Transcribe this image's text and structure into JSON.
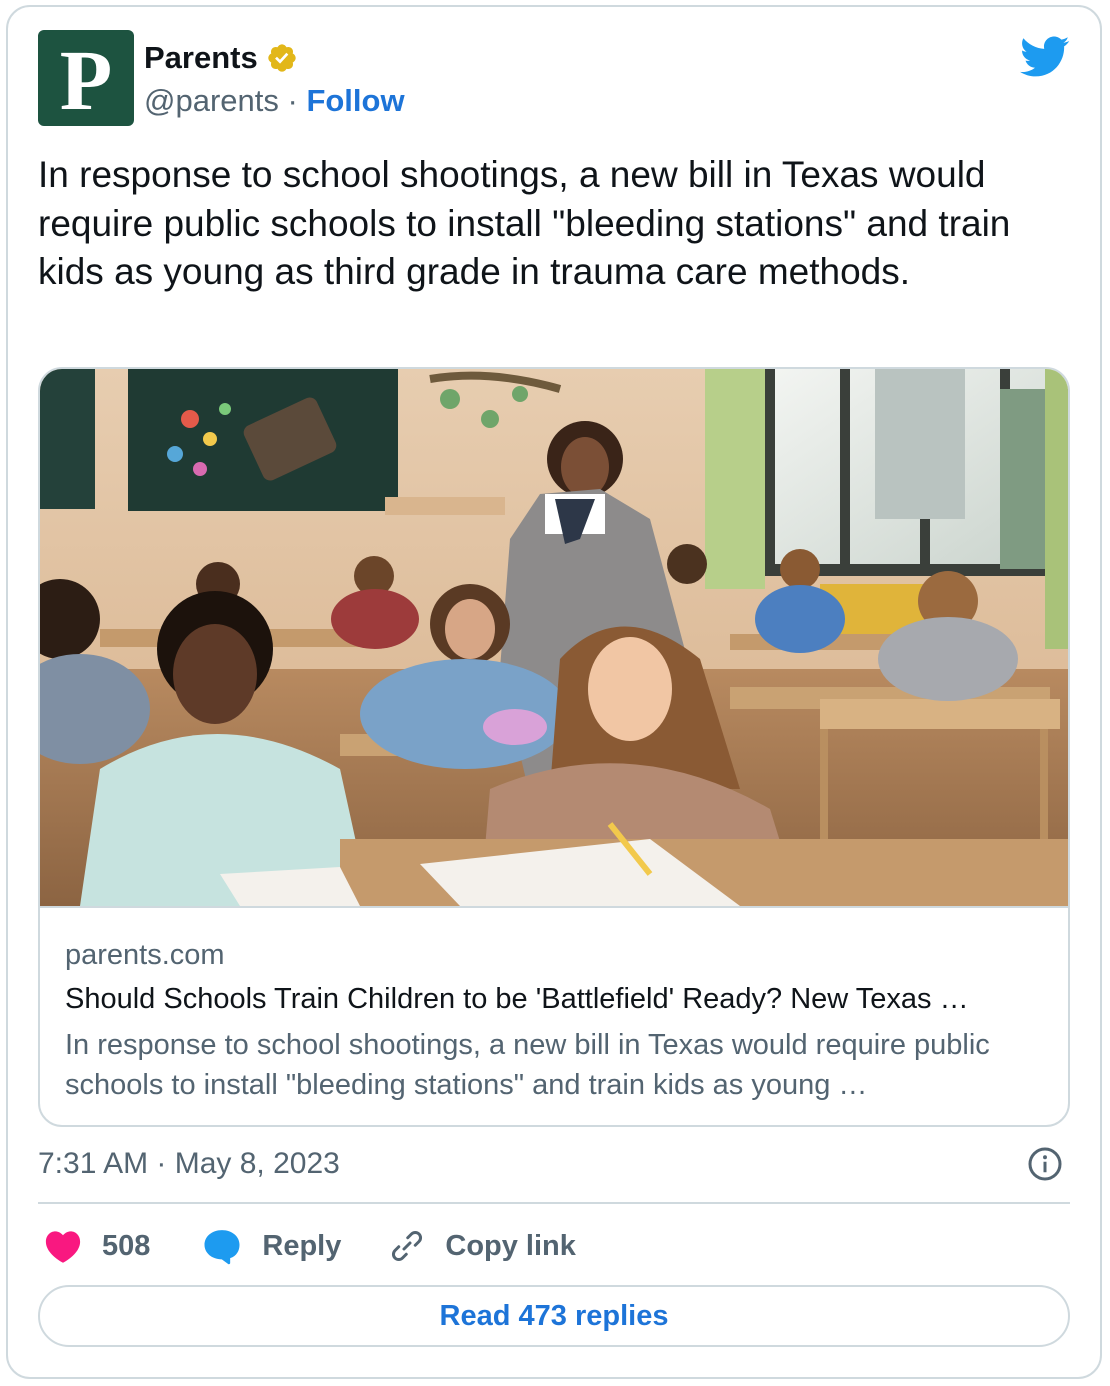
{
  "author": {
    "avatar_letter": "P",
    "avatar_color": "#1d5340",
    "display_name": "Parents",
    "handle": "@parents",
    "separator": " · ",
    "follow_label": "Follow",
    "verified_badge": "gold-verified-badge-icon"
  },
  "tweet": {
    "text": "In response to school shootings, a new bill in Texas would require public schools to install \"bleeding stations\" and train kids as young as third grade in trauma care methods."
  },
  "link_card": {
    "image": "classroom-photo",
    "domain": "parents.com",
    "title": "Should Schools Train Children to be 'Battlefield' Ready? New Texas …",
    "description": "In response to school shootings, a new bill in Texas would require public schools to install \"bleeding stations\" and train kids as young …"
  },
  "meta": {
    "timestamp": "7:31 AM · May 8, 2023"
  },
  "actions": {
    "likes": "508",
    "reply_label": "Reply",
    "copy_link_label": "Copy link"
  },
  "read_replies_label": "Read 473 replies",
  "colors": {
    "accent": "#1d74d8",
    "twitter_blue": "#1d9bf0",
    "like_pink": "#f91880",
    "muted": "#536471",
    "border": "#cfd9de"
  }
}
